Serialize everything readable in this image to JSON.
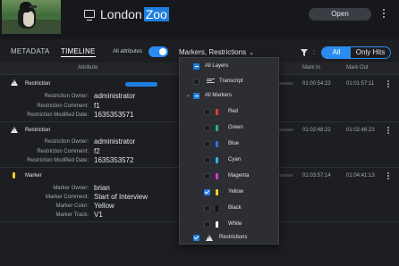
{
  "header": {
    "title_prefix": "London",
    "title_highlight": "Zoo",
    "open_button": "Open"
  },
  "tabs": [
    {
      "label": "METADATA",
      "active": false
    },
    {
      "label": "TIMELINE",
      "active": true
    }
  ],
  "toolbar": {
    "all_attributes_label": "All attributes",
    "all_attributes_on": true,
    "markers_dropdown_label": "Markers, Restrictions",
    "colon": ":",
    "seg_all": "All",
    "seg_only_hits": "Only Hits",
    "seg_selected": "All"
  },
  "columns": {
    "attribute": "Attribute",
    "mark_in": "Mark In",
    "mark_out": "Mark Out"
  },
  "rows": [
    {
      "type": "Restriction",
      "icon": "warning-icon",
      "mark_in": "01:00:54:23",
      "mark_out": "01:01:57:11",
      "fields": [
        {
          "label": "Restriction Owner:",
          "value": "administrator"
        },
        {
          "label": "Restriction Comment:",
          "value": "f1"
        },
        {
          "label": "Restriction Modified Date:",
          "value": "1635353571"
        }
      ]
    },
    {
      "type": "Restriction",
      "icon": "warning-icon",
      "mark_in": "01:02:48:22",
      "mark_out": "01:02:48:23",
      "fields": [
        {
          "label": "Restriction Owner:",
          "value": "administrator"
        },
        {
          "label": "Restriction Comment:",
          "value": "f2"
        },
        {
          "label": "Restriction Modified Date:",
          "value": "1635353572"
        }
      ]
    },
    {
      "type": "Marker",
      "icon": "marker-icon",
      "color": "#f2d21e",
      "mark_in": "01:03:57:14",
      "mark_out": "01:04:41:13",
      "fields": [
        {
          "label": "Marker Owner:",
          "value": "brian"
        },
        {
          "label": "Marker Comment:",
          "value": "Start of Interview"
        },
        {
          "label": "Marker Color:",
          "value": "Yellow"
        },
        {
          "label": "Marker Track:",
          "value": "V1"
        }
      ]
    }
  ],
  "dropdown": {
    "all_layers": "All Layers",
    "transcript": "Transcript",
    "all_markers": "All Markers",
    "markers": [
      {
        "label": "Red",
        "color": "#e53935",
        "checked": false
      },
      {
        "label": "Green",
        "color": "#2bb673",
        "checked": false
      },
      {
        "label": "Blue",
        "color": "#2f6fe4",
        "checked": false
      },
      {
        "label": "Cyan",
        "color": "#29b6f6",
        "checked": false
      },
      {
        "label": "Magenta",
        "color": "#d63ad6",
        "checked": false
      },
      {
        "label": "Yellow",
        "color": "#f2d21e",
        "checked": true
      },
      {
        "label": "Black",
        "color": "#111111",
        "checked": false
      },
      {
        "label": "White",
        "color": "#ffffff",
        "checked": false
      }
    ],
    "restrictions": "Restrictions",
    "restrictions_checked": true
  }
}
